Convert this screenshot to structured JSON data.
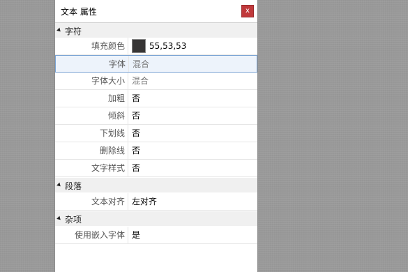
{
  "window": {
    "title": "文本 属性",
    "close_label": "x"
  },
  "groups": {
    "character": "字符",
    "paragraph": "段落",
    "misc": "杂项"
  },
  "rows": {
    "fill_color": {
      "label": "填充颜色",
      "value": "55,53,53",
      "color": "#373535"
    },
    "font": {
      "label": "字体",
      "value": "混合"
    },
    "font_size": {
      "label": "字体大小",
      "value": "混合"
    },
    "bold": {
      "label": "加粗",
      "value": "否"
    },
    "italic": {
      "label": "倾斜",
      "value": "否"
    },
    "underline": {
      "label": "下划线",
      "value": "否"
    },
    "strikethrough": {
      "label": "删除线",
      "value": "否"
    },
    "text_style": {
      "label": "文字样式",
      "value": "否"
    },
    "text_align": {
      "label": "文本对齐",
      "value": "左对齐"
    },
    "embed_font": {
      "label": "使用嵌入字体",
      "value": "是"
    }
  }
}
